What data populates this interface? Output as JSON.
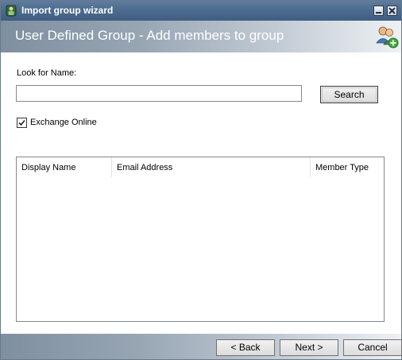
{
  "window": {
    "title": "Import group wizard",
    "banner_title": "User Defined Group - Add members to group"
  },
  "form": {
    "look_for_label": "Look for Name:",
    "search_value": "",
    "search_button": "Search",
    "exchange_online_label": "Exchange Online",
    "exchange_online_checked": true
  },
  "grid": {
    "columns": [
      "Display Name",
      "Email Address",
      "Member Type"
    ],
    "rows": []
  },
  "footer": {
    "back_label": "< Back",
    "next_label": "Next >",
    "cancel_label": "Cancel"
  },
  "icons": {
    "title_icon": "wizard-app-icon",
    "banner_icon": "users-add-icon",
    "minimize": "minimize-icon",
    "close": "close-icon",
    "checkbox": "checkmark-icon"
  }
}
